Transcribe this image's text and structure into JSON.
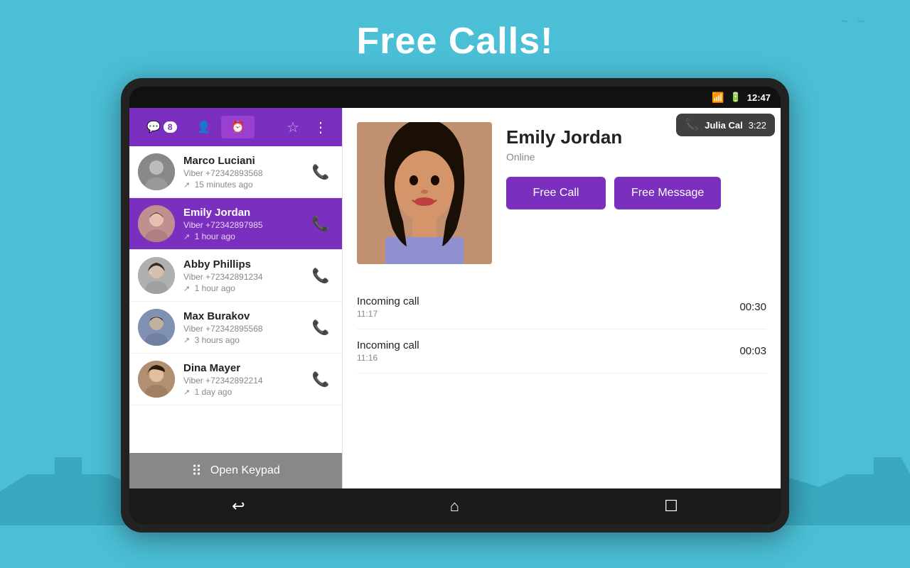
{
  "page": {
    "title": "Free Calls!",
    "background_color": "#4bbfd6"
  },
  "status_bar": {
    "time": "12:47",
    "wifi_icon": "wifi",
    "battery_icon": "battery"
  },
  "nav_bar": {
    "chats_icon": "💬",
    "chats_badge": "8",
    "contacts_icon": "👤",
    "recent_icon": "🕐",
    "star_icon": "★",
    "more_icon": "⋮"
  },
  "contacts": [
    {
      "name": "Marco Luciani",
      "number": "Viber +72342893568",
      "time": "15 minutes ago",
      "direction": "outgoing",
      "selected": false
    },
    {
      "name": "Emily Jordan",
      "number": "Viber +72342897985",
      "time": "1 hour ago",
      "direction": "outgoing",
      "selected": true
    },
    {
      "name": "Abby Phillips",
      "number": "Viber +72342891234",
      "time": "1 hour ago",
      "direction": "outgoing",
      "selected": false
    },
    {
      "name": "Max Burakov",
      "number": "Viber +72342895568",
      "time": "3 hours ago",
      "direction": "incoming",
      "selected": false
    },
    {
      "name": "Dina Mayer",
      "number": "Viber +72342892214",
      "time": "1 day ago",
      "direction": "outgoing",
      "selected": false
    }
  ],
  "keypad": {
    "label": "Open Keypad"
  },
  "profile": {
    "name": "Emily Jordan",
    "status": "Online",
    "free_call_label": "Free Call",
    "free_message_label": "Free Message"
  },
  "notification": {
    "name": "Julia Cal",
    "time": "3:22"
  },
  "call_history": [
    {
      "type": "Incoming call",
      "time": "11:17",
      "duration": "00:30"
    },
    {
      "type": "Incoming call",
      "time": "11:16",
      "duration": "00:03"
    }
  ]
}
